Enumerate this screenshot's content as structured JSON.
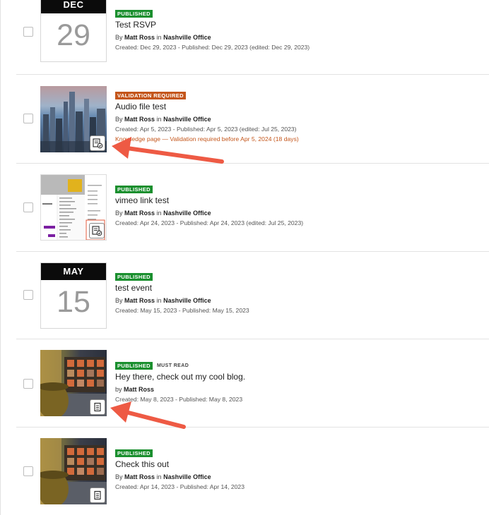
{
  "items": [
    {
      "month": "DEC",
      "day": "29",
      "badge": "PUBLISHED",
      "title": "Test RSVP",
      "by_prefix": "By",
      "author": "Matt Ross",
      "in_word": "in",
      "location": "Nashville Office",
      "meta": "Created: Dec 29, 2023 - Published: Dec 29, 2023 (edited: Dec 29, 2023)"
    },
    {
      "badge": "VALIDATION REQUIRED",
      "title": "Audio file test",
      "by_prefix": "By",
      "author": "Matt Ross",
      "in_word": "in",
      "location": "Nashville Office",
      "meta": "Created: Apr 5, 2023 - Published: Apr 5, 2023 (edited: Jul 25, 2023)",
      "warning": "Knowledge page — Validation required before Apr 5, 2024 (18 days)",
      "thumb_icon": "knowledge-validated-icon"
    },
    {
      "badge": "PUBLISHED",
      "title": "vimeo link test",
      "by_prefix": "By",
      "author": "Matt Ross",
      "in_word": "in",
      "location": "Nashville Office",
      "meta": "Created: Apr 24, 2023 - Published: Apr 24, 2023 (edited: Jul 25, 2023)",
      "thumb_icon": "knowledge-validated-icon"
    },
    {
      "month": "MAY",
      "day": "15",
      "badge": "PUBLISHED",
      "title": "test event",
      "by_prefix": "By",
      "author": "Matt Ross",
      "in_word": "in",
      "location": "Nashville Office",
      "meta": "Created: May 15, 2023 - Published: May 15, 2023"
    },
    {
      "badge": "PUBLISHED",
      "extra_badge": "MUST READ",
      "title": "Hey there, check out my cool blog.",
      "by_prefix": "by",
      "author": "Matt Ross",
      "meta": "Created: May 8, 2023 - Published: May 8, 2023",
      "thumb_icon": "document-icon"
    },
    {
      "badge": "PUBLISHED",
      "title": "Check this out",
      "by_prefix": "By",
      "author": "Matt Ross",
      "in_word": "in",
      "location": "Nashville Office",
      "meta": "Created: Apr 14, 2023 - Published: Apr 14, 2023",
      "thumb_icon": "document-icon"
    }
  ],
  "colors": {
    "published": "#1a8f2e",
    "validation": "#c4561b",
    "arrow": "#ee5a44"
  }
}
